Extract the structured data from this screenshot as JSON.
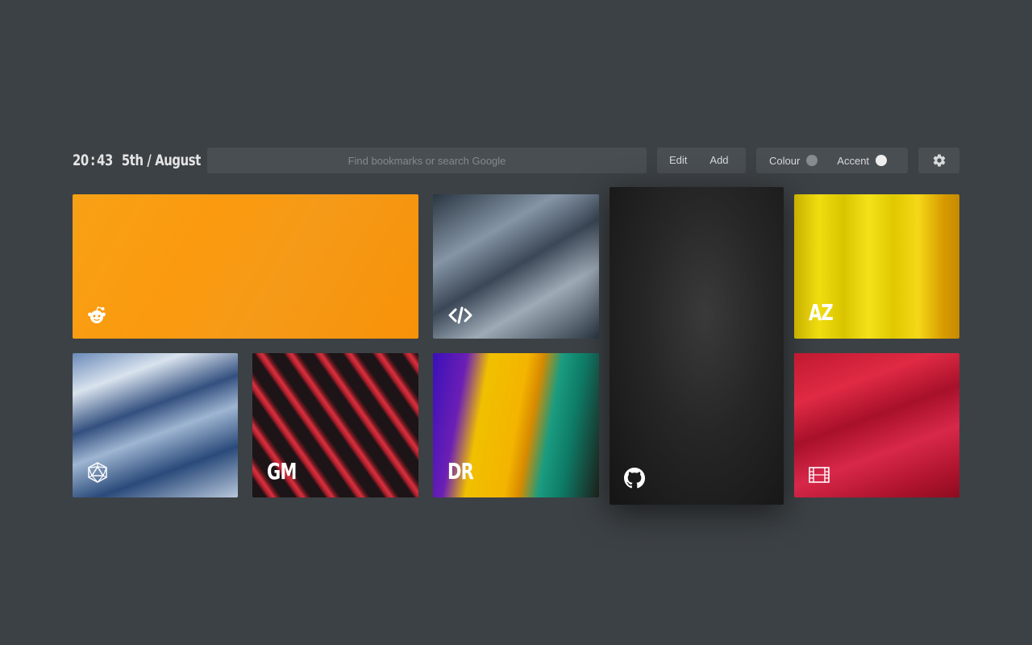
{
  "clock": {
    "hours": "20",
    "separator": ":",
    "minutes": "43",
    "date": "5th / August"
  },
  "search": {
    "placeholder": "Find bookmarks or search Google",
    "value": ""
  },
  "toolbar": {
    "edit_label": "Edit",
    "add_label": "Add"
  },
  "theme": {
    "colour_label": "Colour",
    "colour_state": "off",
    "accent_label": "Accent",
    "accent_state": "on"
  },
  "settings": {
    "icon": "gear-icon"
  },
  "bookmarks": [
    {
      "id": "reddit",
      "icon": "reddit-icon",
      "letters": "",
      "bg": "#f99c12"
    },
    {
      "id": "code",
      "icon": "code-icon",
      "letters": "",
      "bg": "#6b7a8a"
    },
    {
      "id": "github",
      "icon": "github-icon",
      "letters": "",
      "bg": "#222222",
      "active": true
    },
    {
      "id": "az",
      "icon": "",
      "letters": "AZ",
      "bg": "#e3c717"
    },
    {
      "id": "dice",
      "icon": "d20-icon",
      "letters": "",
      "bg": "#3d5f92"
    },
    {
      "id": "gm",
      "icon": "",
      "letters": "GM",
      "bg": "#8b1d24"
    },
    {
      "id": "dr",
      "icon": "",
      "letters": "DR",
      "bg": "#c58b17"
    },
    {
      "id": "film",
      "icon": "film-icon",
      "letters": "",
      "bg": "#c81a34"
    }
  ],
  "colors": {
    "background": "#3c4145",
    "control_bg": "#494e52",
    "text": "#d7d9db"
  }
}
